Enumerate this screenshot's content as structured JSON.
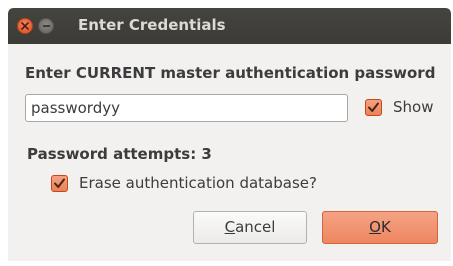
{
  "window": {
    "title": "Enter Credentials"
  },
  "form": {
    "heading": "Enter CURRENT master authentication password",
    "password_value": "passwordyy",
    "show_label": "Show",
    "show_checked": true,
    "attempts_label": "Password attempts: 3",
    "erase_label": "Erase authentication database?",
    "erase_checked": true
  },
  "buttons": {
    "cancel_mnemonic": "C",
    "cancel_rest": "ancel",
    "ok_mnemonic": "O",
    "ok_rest": "K"
  },
  "colors": {
    "titlebar": "#3c3b37",
    "accent": "#ee8660",
    "dialog_bg": "#f2f1f0"
  }
}
